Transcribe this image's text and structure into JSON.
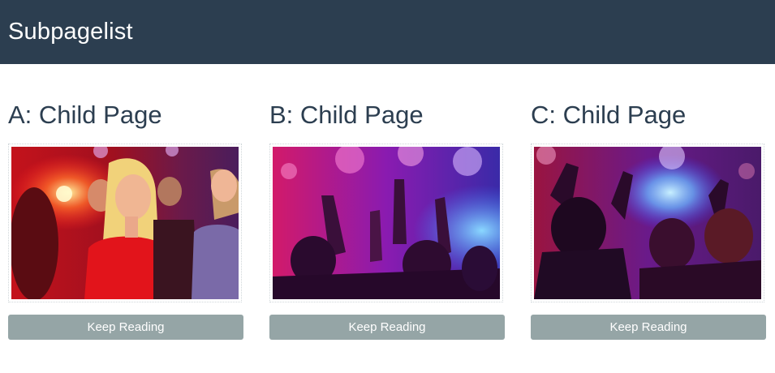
{
  "header": {
    "title": "Subpagelist"
  },
  "pages": [
    {
      "title": "A: Child Page",
      "button_label": "Keep Reading",
      "image": "party-crowd-smiling-woman"
    },
    {
      "title": "B: Child Page",
      "button_label": "Keep Reading",
      "image": "concert-crowd-raised-hands"
    },
    {
      "title": "C: Child Page",
      "button_label": "Keep Reading",
      "image": "concert-crowd-stage-lights"
    }
  ],
  "colors": {
    "header_bg": "#2c3e50",
    "title_text": "#2c3e50",
    "button_bg": "#95a5a6",
    "button_text": "#ffffff"
  }
}
